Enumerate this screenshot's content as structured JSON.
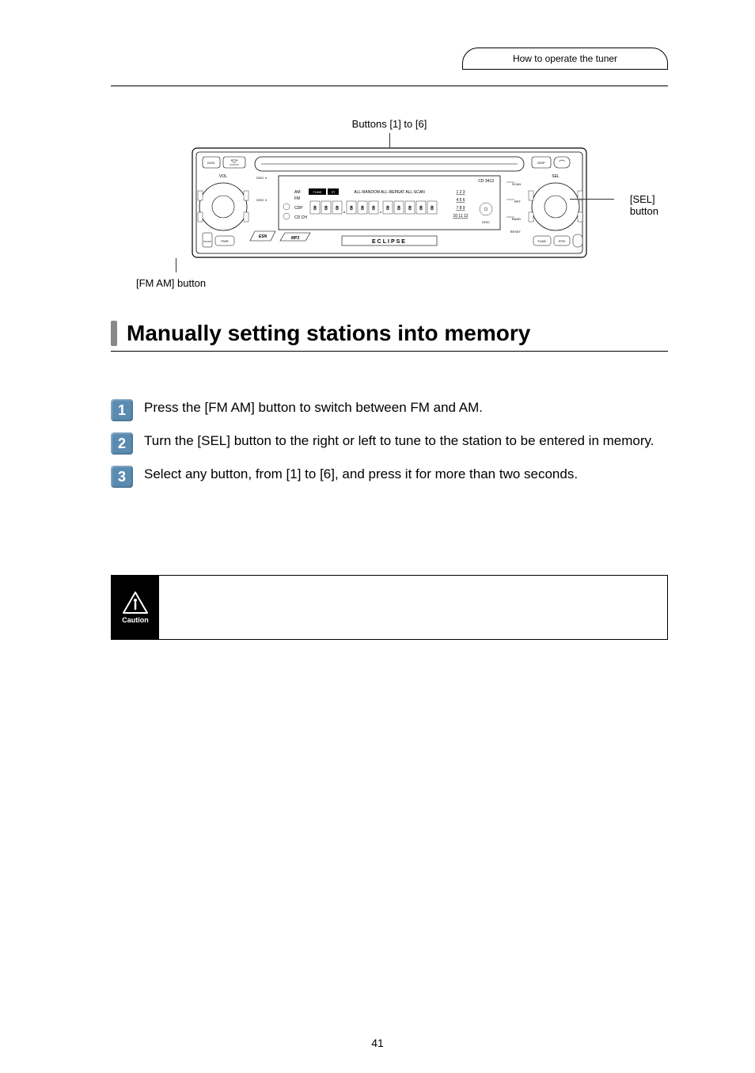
{
  "header": {
    "tab_label": "How to operate the tuner"
  },
  "diagram": {
    "callout_top": "Buttons [1] to [6]",
    "callout_right_line1": "[SEL]",
    "callout_right_line2": "button",
    "callout_bottom": "[FM AM] button",
    "display_text_cd": "CD 3413",
    "display_text_mode": "ALL-RANDOM  ALL-REPEAT  ALL-SCAN",
    "display_text_am": "AM",
    "display_text_fm": "FM",
    "display_text_cdp": "CDP",
    "display_text_cdch": "CD CH",
    "brand": "ECLIPSE",
    "btn_disc": "DISC",
    "btn_vol": "VOL",
    "btn_disc_down": "DISC",
    "btn_pwr": "PWR",
    "btn_fm_am": "FM AM",
    "btn_esn": "ESN",
    "btn_disp": "DISP",
    "btn_sel": "SEL",
    "btn_scan": "SCAN",
    "btn_rpt": "RPT",
    "btn_rand": "RAND",
    "btn_reset": "RESET",
    "btn_func": "FUNC",
    "btn_rtn": "RTN",
    "numbers_row1": "1 2 3",
    "numbers_row2": "4 5 6",
    "numbers_row3": "7 8 9",
    "numbers_row4": "10 11 12"
  },
  "title": "Manually setting stations into memory",
  "steps": [
    {
      "n": "1",
      "text": "Press the [FM AM] button to switch between FM and AM."
    },
    {
      "n": "2",
      "text": "Turn the [SEL] button to the right or left to tune to the station to be entered in memory."
    },
    {
      "n": "3",
      "text": "Select any button, from [1] to [6], and press it for more than two seconds."
    }
  ],
  "caution": {
    "label": "Caution"
  },
  "page_number": "41"
}
